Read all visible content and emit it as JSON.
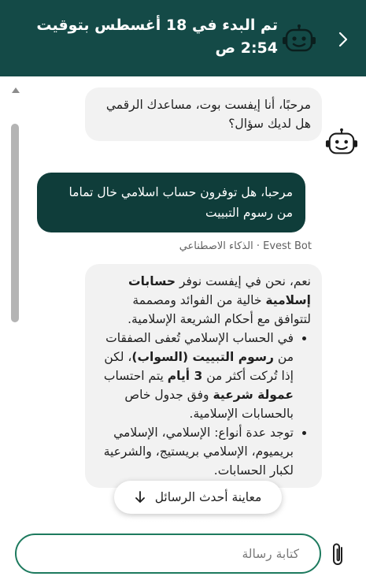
{
  "header": {
    "title": "تم البدء في 18 أغسطس بتوقيت 2:54 ص",
    "bot_icon": "robot-icon",
    "back_icon": "chevron-right-icon"
  },
  "colors": {
    "header_bg": "#144a47",
    "user_bubble": "#0f3d3a",
    "bot_bubble": "#f2f2f2",
    "input_border": "#1d7a5e"
  },
  "messages": {
    "welcome": {
      "line1": "مرحبًا، أنا إيفست بوت، مساعدك الرقمي",
      "line2": "هل لديك سؤال؟"
    },
    "user": {
      "text": "مرحبا، هل توفرون حساب اسلامي خال تماما من رسوم التبييت"
    },
    "reply_meta": "Evest Bot · الذكاء الاصطناعي",
    "reply": {
      "intro_1": "نعم، نحن في إيفست نوفر ",
      "intro_bold": "حسابات إسلامية",
      "intro_2": " خالية من الفوائد ومصممة لتتوافق مع أحكام الشريعة الإسلامية.",
      "b1_1": "في الحساب الإسلامي تُعفى الصفقات من ",
      "b1_bold1": "رسوم التبييت (السواب)",
      "b1_2": "، لكن إذا تُركت أكثر من ",
      "b1_bold2": "3 أيام",
      "b1_3": " يتم احتساب ",
      "b1_bold3": "عمولة شرعية",
      "b1_4": " وفق جدول خاص بالحسابات الإسلامية.",
      "b2": "توجد عدة أنواع: الإسلامي، الإسلامي بريميوم، الإسلامي بريستيج، والشرعية لكبار الحسابات."
    }
  },
  "preview_button": {
    "label": "معاينة أحدث الرسائل"
  },
  "composer": {
    "placeholder": "كتابة رسالة",
    "attach_icon": "paperclip-icon"
  }
}
